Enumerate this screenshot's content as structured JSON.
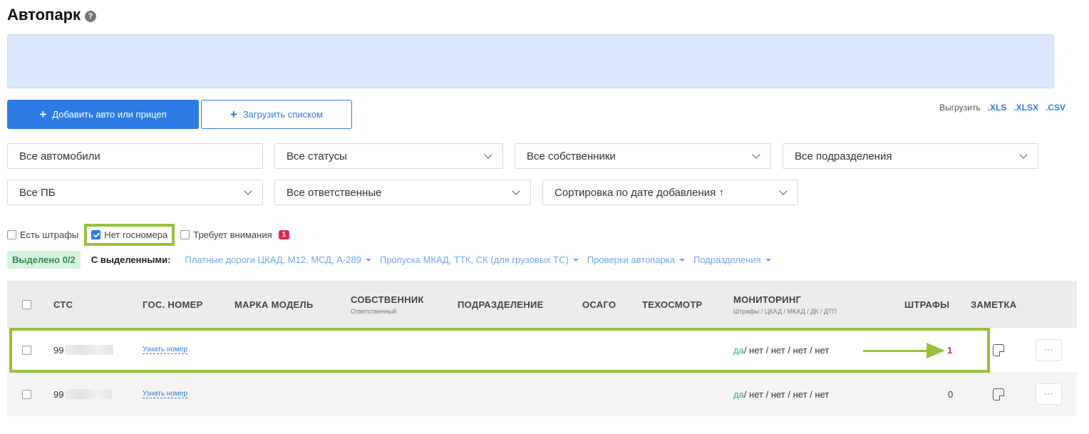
{
  "page": {
    "title": "Автопарк",
    "help_icon": "question-circle-icon"
  },
  "actions": {
    "add_label": "Добавить авто или прицеп",
    "upload_label": "Загрузить списком",
    "export_label": "Выгрузить",
    "export_formats": [
      ".XLS",
      ".XLSX",
      ".CSV"
    ]
  },
  "filters": {
    "cars": "Все автомобили",
    "statuses": "Все статусы",
    "owners": "Все собственники",
    "divisions": "Все подразделения",
    "pb": "Все ПБ",
    "responsible": "Все ответственные",
    "sort": "Сортировка по дате добавления ↑"
  },
  "checkboxes": {
    "fines": {
      "label": "Есть штрафы",
      "checked": false
    },
    "no_plate": {
      "label": "Нет госномера",
      "checked": true
    },
    "attention": {
      "label": "Требует внимания",
      "checked": false,
      "badge": "1"
    }
  },
  "bulk": {
    "selected": "Выделено 0/2",
    "label": "С выделенными:",
    "items": [
      "Платные дороги ЦКАД, М12, МСД, А-289",
      "Пропуска МКАД, ТТК, СК (для грузовых ТС)",
      "Проверки автопарка",
      "Подразделения"
    ]
  },
  "table": {
    "headers": {
      "sts": "СТС",
      "plate": "ГОС. НОМЕР",
      "model": "МАРКА МОДЕЛЬ",
      "owner": "СОБСТВЕННИК",
      "owner_sub": "Ответственный",
      "division": "ПОДРАЗДЕЛЕНИЕ",
      "osago": "ОСАГО",
      "inspection": "ТЕХОСМОТР",
      "monitoring": "МОНИТОРИНГ",
      "monitoring_sub": "Штрафы / ЦКАД / МКАД / ДК / ДТП",
      "fines": "ШТРАФЫ",
      "note": "ЗАМЕТКА"
    },
    "rows": [
      {
        "sts": "99",
        "plate_link": "Узнать номер",
        "mon_yes": "да",
        "mon_rest": " / нет / нет / нет / нет",
        "fines": "1"
      },
      {
        "sts": "99",
        "plate_link": "Узнать номер",
        "mon_yes": "да",
        "mon_rest": " / нет / нет / нет / нет",
        "fines": "0"
      }
    ],
    "more_label": "···"
  },
  "colors": {
    "accent": "#2d7be5",
    "highlight": "#97c13c",
    "danger": "#e3244a",
    "success": "#2fb35b"
  }
}
